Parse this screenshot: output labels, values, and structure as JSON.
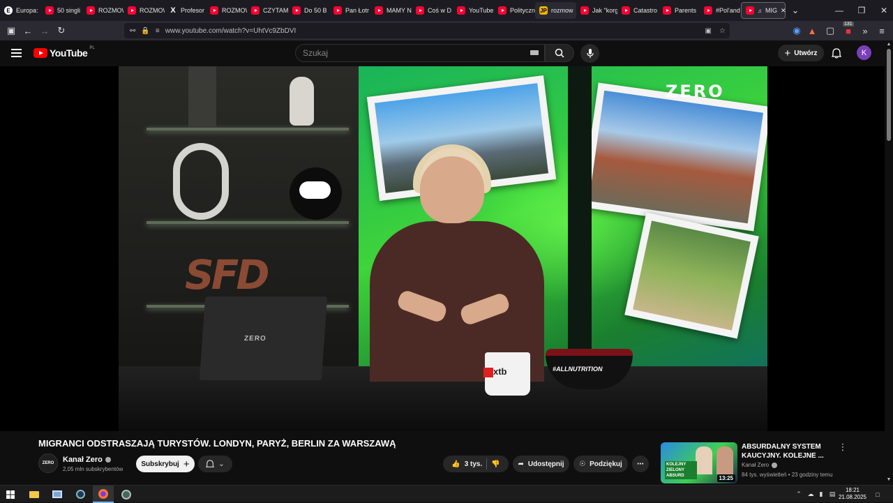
{
  "browser": {
    "tabs": [
      {
        "title": "Europa:",
        "icon": "site-icon"
      },
      {
        "title": "50 singli",
        "icon": "youtube-icon"
      },
      {
        "title": "ROZMOWA",
        "icon": "youtube-icon"
      },
      {
        "title": "ROZMOW",
        "icon": "youtube-icon"
      },
      {
        "title": "Profesor",
        "icon": "x-icon"
      },
      {
        "title": "ROZMOW",
        "icon": "youtube-icon"
      },
      {
        "title": "CZYTAM",
        "icon": "youtube-icon"
      },
      {
        "title": "Do 50 B",
        "icon": "youtube-icon"
      },
      {
        "title": "Pan Łotr",
        "icon": "youtube-icon"
      },
      {
        "title": "MAMY N",
        "icon": "youtube-icon"
      },
      {
        "title": "Coś w D",
        "icon": "youtube-icon"
      },
      {
        "title": "YouTube",
        "icon": "youtube-icon"
      },
      {
        "title": "Polityczn",
        "icon": "youtube-icon"
      },
      {
        "title": "rozmow",
        "icon": "jp-icon"
      },
      {
        "title": "Jak \"korg",
        "icon": "youtube-icon"
      },
      {
        "title": "Catastro",
        "icon": "youtube-icon"
      },
      {
        "title": "Parents",
        "icon": "youtube-icon"
      },
      {
        "title": "#Pol'and",
        "icon": "youtube-icon"
      },
      {
        "title": "MIG",
        "icon": "youtube-icon"
      }
    ],
    "url": "www.youtube.com/watch?v=UhtVc9ZbDVI",
    "extension_badge": "131"
  },
  "youtube": {
    "logo_text": "YouTube",
    "region": "PL",
    "search_placeholder": "Szukaj",
    "create_label": "Utwórz",
    "avatar_letter": "K"
  },
  "video": {
    "title": "MIGRANCI ODSTRASZAJĄ TURYSTÓW. LONDYN, PARYŻ, BERLIN ZA WARSZAWĄ",
    "channel": "Kanał Zero",
    "channel_avatar_text": "ZERO",
    "subscribers": "2,05 mln subskrybentów",
    "subscribe_label": "Subskrybuj",
    "likes": "3 tys.",
    "share_label": "Udostępnij",
    "thanks_label": "Podziękuj",
    "scene": {
      "left_logo": "SFD",
      "right_logo": "ZERO",
      "laptop_text": "ZERO",
      "mug_text": "xtb",
      "bowl_text": "#ALLNUTRITION"
    }
  },
  "recommended": {
    "title": "ABSURDALNY SYSTEM KAUCYJNY. KOLEJNE ...",
    "channel": "Kanał Zero",
    "meta": "84 tys. wyświetleń • 23 godziny temu",
    "duration": "13:25",
    "thumb_label": "KOLEJNY ZIELONY ABSURD"
  },
  "taskbar": {
    "time": "18:21",
    "date": "21.08.2025"
  },
  "colors": {
    "youtube_red": "#ff0000",
    "background": "#0f0f0f",
    "avatar": "#7b3fb9"
  }
}
